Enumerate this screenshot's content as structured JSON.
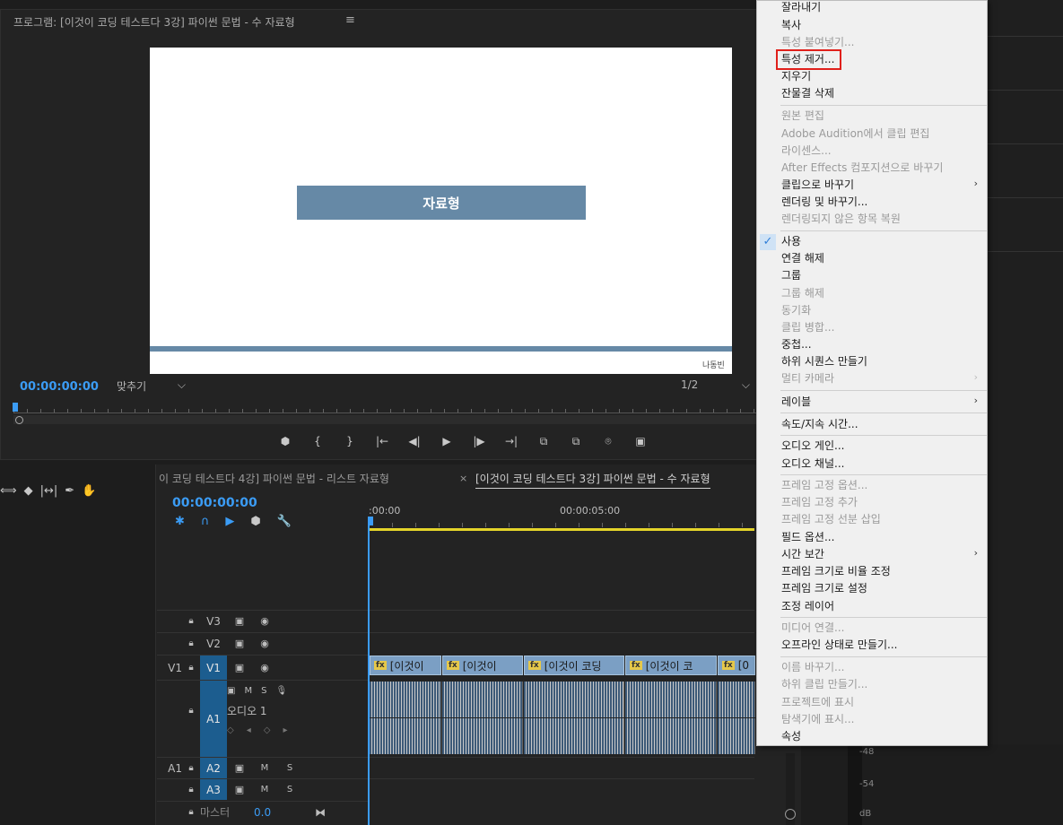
{
  "program_monitor": {
    "title": "프로그램: [이것이 코딩 테스트다 3강] 파이썬 문법 - 수 자료형",
    "menu_icon": "≡",
    "slide_title": "자료형",
    "author": "나동빈",
    "timecode": "00:00:00:00",
    "fit": "맞추기",
    "resolution": "1/2",
    "dropdown_arrow": "⌵"
  },
  "transport": [
    "⬢",
    "{",
    "}",
    "|←",
    "◀|",
    "▶",
    "|▶",
    "→|",
    "⧉",
    "⧉",
    "⌾",
    "▣"
  ],
  "tools": [
    "⟺",
    "◆",
    "|↔|",
    "✒",
    "✋"
  ],
  "timeline": {
    "tab_1": "이 코딩 테스트다 4강] 파이썬 문법 - 리스트 자료형",
    "tab_close": "×",
    "tab_2": "[이것이 코딩 테스트다 3강] 파이썬 문법 - 수 자료형",
    "timecode": "00:00:00:00",
    "tools": [
      "✱",
      "∩",
      "▶",
      "⬢",
      "🔧"
    ],
    "time_start": ":00:00",
    "time_5": "00:00:05:00",
    "tracks": {
      "v3": "V3",
      "v2": "V2",
      "v1_src": "V1",
      "v1": "V1",
      "a1": "A1",
      "a1_name": "오디오 1",
      "a2_src": "A1",
      "a2": "A2",
      "a3": "A3",
      "master": "마스터",
      "master_value": "0.0",
      "m": "M",
      "s": "S"
    },
    "clips": [
      "[이것이",
      "[이것이",
      "[이것이 코딩",
      "[이것이 코",
      "[0"
    ],
    "fx": "fx"
  },
  "meters": {
    "m48": "-48",
    "m54": "-54",
    "db": "dB"
  },
  "menu": {
    "items": [
      {
        "label": "잘라내기",
        "enabled": true
      },
      {
        "label": "복사",
        "enabled": true
      },
      {
        "label": "특성 붙여넣기...",
        "enabled": false
      },
      {
        "label": "특성 제거...",
        "enabled": true
      },
      {
        "label": "지우기",
        "enabled": true
      },
      {
        "label": "잔물결 삭제",
        "enabled": true
      },
      {
        "label": "원본 편집",
        "enabled": false
      },
      {
        "label": "Adobe Audition에서 클립 편집",
        "enabled": false
      },
      {
        "label": "라이센스...",
        "enabled": false
      },
      {
        "label": "After Effects 컴포지션으로 바꾸기",
        "enabled": false
      },
      {
        "label": "클립으로 바꾸기",
        "enabled": true
      },
      {
        "label": "렌더링 및 바꾸기...",
        "enabled": true
      },
      {
        "label": "렌더링되지 않은 항목 복원",
        "enabled": false
      },
      {
        "label": "사용",
        "enabled": true
      },
      {
        "label": "연결 해제",
        "enabled": true
      },
      {
        "label": "그룹",
        "enabled": true
      },
      {
        "label": "그룹 해제",
        "enabled": false
      },
      {
        "label": "동기화",
        "enabled": false
      },
      {
        "label": "클립 병합...",
        "enabled": false
      },
      {
        "label": "중첩...",
        "enabled": true
      },
      {
        "label": "하위 시퀀스 만들기",
        "enabled": true
      },
      {
        "label": "멀티 카메라",
        "enabled": false
      },
      {
        "label": "레이블",
        "enabled": true
      },
      {
        "label": "속도/지속 시간...",
        "enabled": true
      },
      {
        "label": "오디오 게인...",
        "enabled": true
      },
      {
        "label": "오디오 채널...",
        "enabled": true
      },
      {
        "label": "프레임 고정 옵션...",
        "enabled": false
      },
      {
        "label": "프레임 고정 추가",
        "enabled": false
      },
      {
        "label": "프레임 고정 선분 삽입",
        "enabled": false
      },
      {
        "label": "필드 옵션...",
        "enabled": true
      },
      {
        "label": "시간 보간",
        "enabled": true
      },
      {
        "label": "프레임 크기로 비율 조정",
        "enabled": true
      },
      {
        "label": "프레임 크기로 설정",
        "enabled": true
      },
      {
        "label": "조정 레이어",
        "enabled": true
      },
      {
        "label": "미디어 연결...",
        "enabled": false
      },
      {
        "label": "오프라인 상태로 만들기...",
        "enabled": true
      },
      {
        "label": "이름 바꾸기...",
        "enabled": false
      },
      {
        "label": "하위 클립 만들기...",
        "enabled": false
      },
      {
        "label": "프로젝트에 표시",
        "enabled": false
      },
      {
        "label": "탐색기에 표시...",
        "enabled": false
      },
      {
        "label": "속성",
        "enabled": true
      }
    ],
    "submenu_arrow": "›",
    "check": "✓"
  },
  "colors": {
    "accent": "#3b9cf5",
    "highlight": "#e0201b",
    "slide_bar": "#6689a6"
  }
}
